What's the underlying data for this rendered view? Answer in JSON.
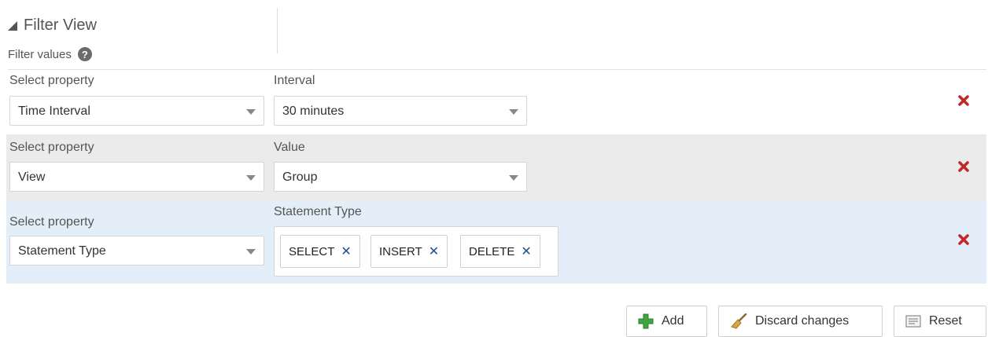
{
  "header": {
    "title": "Filter View"
  },
  "filter_values": {
    "label": "Filter values",
    "help_glyph": "?"
  },
  "rows": [
    {
      "property_label": "Select property",
      "property_value": "Time Interval",
      "value_label": "Interval",
      "value_value": "30 minutes"
    },
    {
      "property_label": "Select property",
      "property_value": "View",
      "value_label": "Value",
      "value_value": "Group"
    },
    {
      "property_label": "Select property",
      "property_value": "Statement Type",
      "value_label": "Statement Type",
      "tags": [
        "SELECT",
        "INSERT",
        "DELETE"
      ]
    }
  ],
  "tag_remove_glyph": "✕",
  "buttons": {
    "add": "Add",
    "discard": "Discard changes",
    "reset": "Reset"
  },
  "colors": {
    "delete_icon": "#c0282b",
    "add_icon": "#3fa33f",
    "row_alt": "#ebebeb",
    "row_selected": "#e3eef9",
    "tag_remove": "#1f4e8c"
  }
}
